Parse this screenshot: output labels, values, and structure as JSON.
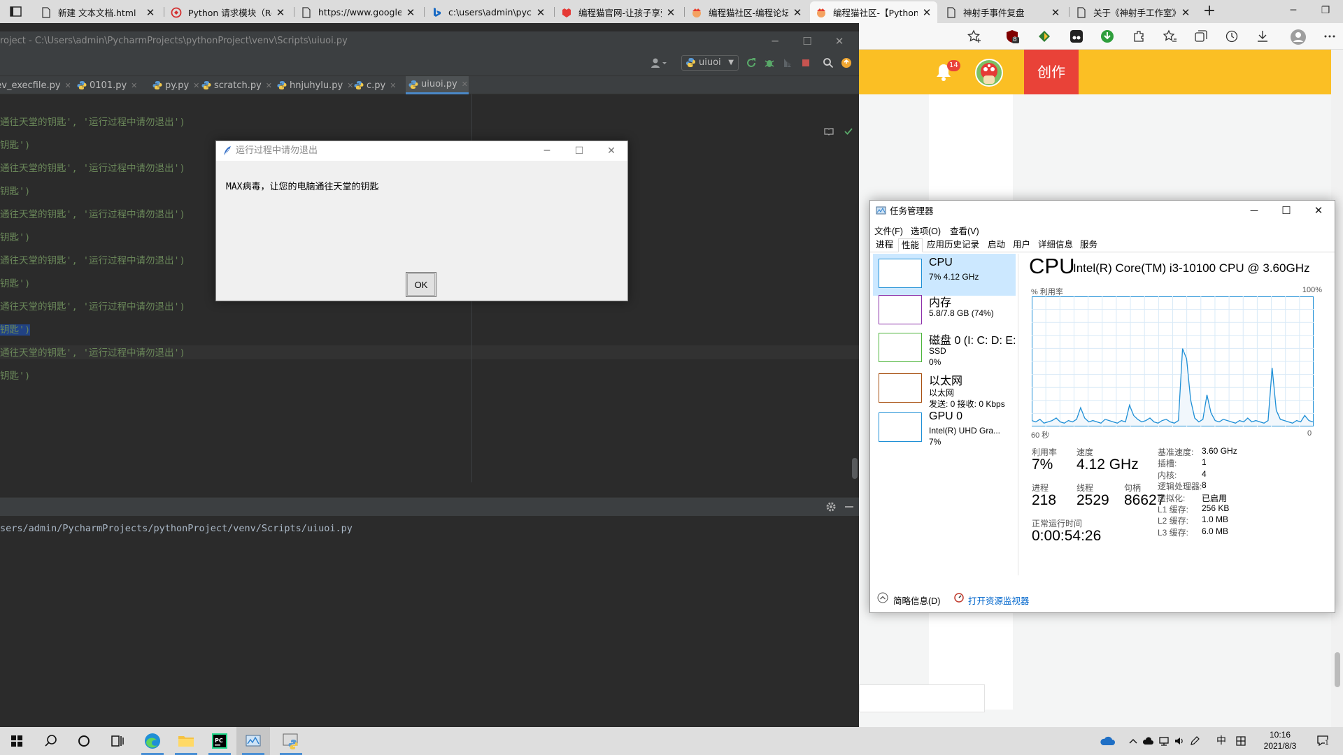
{
  "browser": {
    "tabs": [
      {
        "label": "新建 文本文档.html",
        "icon": "document-icon",
        "active": false
      },
      {
        "label": "Python 请求模块（Requests）",
        "icon": "red-hat-icon",
        "active": false
      },
      {
        "label": "https://www.googletagmanager.com",
        "icon": "document-icon",
        "active": false
      },
      {
        "label": "c:\\users\\admin\\pycharmprojects",
        "icon": "bing-icon",
        "active": false
      },
      {
        "label": "编程猫官网-让孩子享受编程",
        "icon": "codemao-icon",
        "active": false
      },
      {
        "label": "编程猫社区-编程论坛",
        "icon": "codemao-icon",
        "active": false
      },
      {
        "label": "编程猫社区-【Python】",
        "icon": "codemao-icon",
        "active": true
      },
      {
        "label": "神射手事件复盘",
        "icon": "document-icon",
        "active": false
      },
      {
        "label": "关于《神射手工作室》",
        "icon": "document-icon",
        "active": false
      }
    ],
    "toolbar_badge": "8",
    "page": {
      "notification_count": "14",
      "create_label": "创作"
    }
  },
  "ide": {
    "title": "roject - C:\\Users\\admin\\PycharmProjects\\pythonProject\\venv\\Scripts\\uiuoi.py",
    "run_config": "uiuoi",
    "tabs": [
      {
        "label": "dev_execfile.py",
        "active": false
      },
      {
        "label": "0101.py",
        "active": false
      },
      {
        "label": "py.py",
        "active": false
      },
      {
        "label": "scratch.py",
        "active": false
      },
      {
        "label": "hnjuhylu.py",
        "active": false
      },
      {
        "label": "c.py",
        "active": false
      },
      {
        "label": "uiuoi.py",
        "active": true
      }
    ],
    "code_lines": [
      {
        "text": "通往天堂的钥匙', '运行过程中请勿退出')",
        "kind": "call"
      },
      {
        "text": "钥匙')",
        "kind": "end"
      },
      {
        "text": "通往天堂的钥匙', '运行过程中请勿退出')",
        "kind": "call"
      },
      {
        "text": "钥匙')",
        "kind": "end"
      },
      {
        "text": "通往天堂的钥匙', '运行过程中请勿退出')",
        "kind": "call"
      },
      {
        "text": "钥匙')",
        "kind": "end"
      },
      {
        "text": "通往天堂的钥匙', '运行过程中请勿退出')",
        "kind": "call"
      },
      {
        "text": "钥匙')",
        "kind": "end"
      },
      {
        "text": "通往天堂的钥匙', '运行过程中请勿退出')",
        "kind": "call"
      },
      {
        "text": "钥匙')",
        "kind": "end"
      },
      {
        "text": "通往天堂的钥匙', '运行过程中请勿退出')",
        "kind": "call"
      },
      {
        "text": "钥匙')",
        "kind": "end"
      }
    ],
    "run_output": "sers/admin/PycharmProjects/pythonProject/venv/Scripts/uiuoi.py"
  },
  "dialog": {
    "title": "运行过程中请勿退出",
    "message": "MAX病毒，让您的电脑通往天堂的钥匙",
    "ok_label": "OK"
  },
  "taskmgr": {
    "title": "任务管理器",
    "menu": [
      "文件(F)",
      "选项(O)",
      "查看(V)"
    ],
    "tabs": [
      "进程",
      "性能",
      "应用历史记录",
      "启动",
      "用户",
      "详细信息",
      "服务"
    ],
    "active_tab": "性能",
    "resources": [
      {
        "name": "CPU",
        "sub1": "7% 4.12 GHz",
        "sub2": "",
        "sub3": "",
        "color": "#1e8fd6",
        "active": true
      },
      {
        "name": "内存",
        "sub1": "5.8/7.8 GB (74%)",
        "sub2": "",
        "sub3": "",
        "color": "#8b2fa9",
        "active": false
      },
      {
        "name": "磁盘 0 (I: C: D: E:",
        "sub1": "SSD",
        "sub2": "0%",
        "sub3": "",
        "color": "#4db53b",
        "active": false
      },
      {
        "name": "以太网",
        "sub1": "以太网",
        "sub2": "发送: 0 接收: 0 Kbps",
        "sub3": "",
        "color": "#a74f0f",
        "active": false
      },
      {
        "name": "GPU 0",
        "sub1": "Intel(R) UHD Gra...",
        "sub2": "7%",
        "sub3": "",
        "color": "#1e8fd6",
        "active": false
      }
    ],
    "cpu": {
      "heading": "CPU",
      "model": "Intel(R) Core(TM) i3-10100 CPU @ 3.60GHz",
      "util_label": "% 利用率",
      "util_max": "100%",
      "time_left": "60 秒",
      "time_right": "0",
      "utilization_label": "利用率",
      "utilization": "7%",
      "speed_label": "速度",
      "speed": "4.12 GHz",
      "processes_label": "进程",
      "processes": "218",
      "threads_label": "线程",
      "threads": "2529",
      "handles_label": "句柄",
      "handles": "86627",
      "uptime_label": "正常运行时间",
      "uptime": "0:00:54:26",
      "specs": [
        {
          "label": "基准速度:",
          "value": "3.60 GHz"
        },
        {
          "label": "插槽:",
          "value": "1"
        },
        {
          "label": "内核:",
          "value": "4"
        },
        {
          "label": "逻辑处理器:",
          "value": "8"
        },
        {
          "label": "虚拟化:",
          "value": "已启用"
        },
        {
          "label": "L1 缓存:",
          "value": "256 KB"
        },
        {
          "label": "L2 缓存:",
          "value": "1.0 MB"
        },
        {
          "label": "L3 缓存:",
          "value": "6.0 MB"
        }
      ],
      "history": [
        4,
        3,
        5,
        2,
        3,
        4,
        6,
        3,
        2,
        4,
        3,
        5,
        14,
        6,
        3,
        4,
        3,
        2,
        5,
        4,
        3,
        2,
        4,
        3,
        16,
        8,
        5,
        3,
        4,
        6,
        3,
        2,
        4,
        5,
        3,
        2,
        4,
        60,
        52,
        20,
        6,
        3,
        5,
        24,
        10,
        4,
        3,
        5,
        4,
        3,
        2,
        4,
        3,
        6,
        3,
        4,
        3,
        2,
        4,
        45,
        12,
        5,
        4,
        3,
        2,
        4,
        3,
        8,
        4,
        3
      ]
    },
    "fewer_details": "简略信息(D)",
    "open_resmon": "打开资源监视器"
  },
  "taskbar": {
    "time": "10:16",
    "date": "2021/8/3",
    "ime": "中",
    "notif_count": "1"
  }
}
